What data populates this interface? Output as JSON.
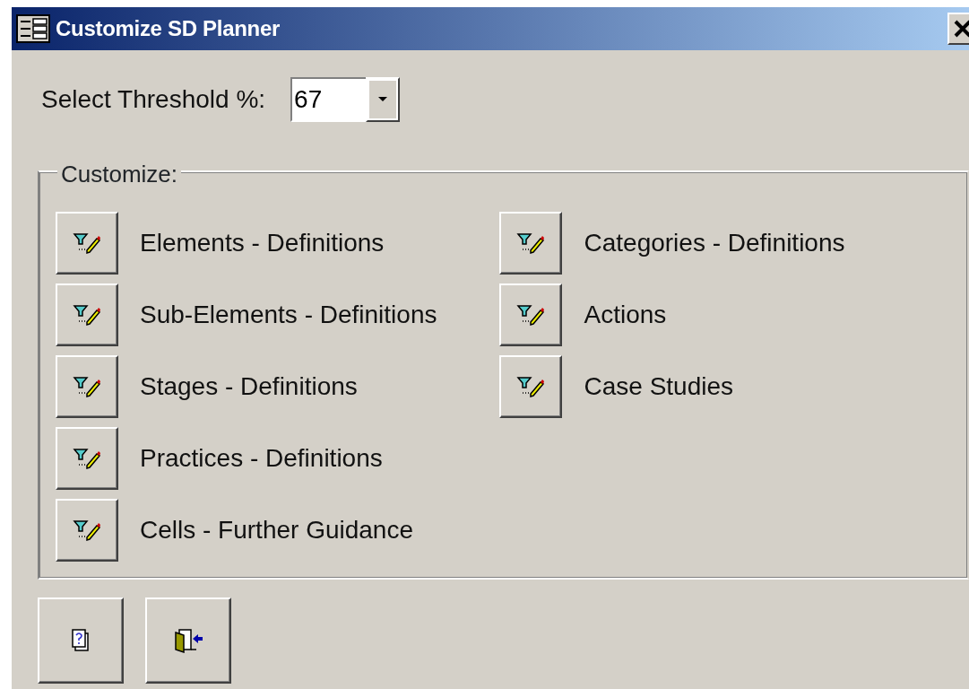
{
  "window": {
    "title": "Customize SD Planner"
  },
  "threshold": {
    "label": "Select Threshold %:",
    "value": "67"
  },
  "group": {
    "label": "Customize:",
    "columns": [
      [
        {
          "label": "Elements - Definitions"
        },
        {
          "label": "Sub-Elements - Definitions"
        },
        {
          "label": "Stages - Definitions"
        },
        {
          "label": "Practices - Definitions"
        },
        {
          "label": "Cells - Further Guidance"
        }
      ],
      [
        {
          "label": "Categories - Definitions"
        },
        {
          "label": "Actions"
        },
        {
          "label": "Case Studies"
        }
      ]
    ]
  },
  "footer_buttons": [
    {
      "kind": "help"
    },
    {
      "kind": "exit"
    }
  ]
}
